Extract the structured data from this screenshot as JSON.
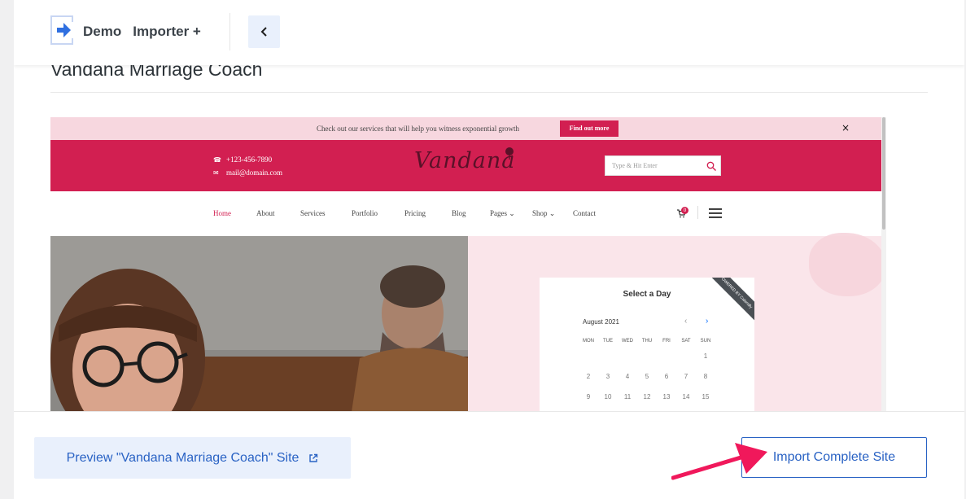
{
  "header": {
    "brand_word1": "Demo",
    "brand_word2": "Importer +",
    "back_icon": "chevron-left-icon"
  },
  "site_title": "Vandana Marriage Coach",
  "site_preview": {
    "topbar": {
      "message": "Check out our services that will help you witness exponential growth",
      "cta": "Find out more",
      "close": "×"
    },
    "contact": {
      "phone": "+123-456-7890",
      "email": "mail@domain.com"
    },
    "logo_text": "Vandana",
    "search_placeholder": "Type & Hit Enter",
    "nav": [
      {
        "label": "Home"
      },
      {
        "label": "About"
      },
      {
        "label": "Services"
      },
      {
        "label": "Portfolio"
      },
      {
        "label": "Pricing"
      },
      {
        "label": "Blog"
      },
      {
        "label": "Pages ⌄"
      },
      {
        "label": "Shop ⌄"
      },
      {
        "label": "Contact"
      }
    ],
    "cart_count": "0",
    "calendar": {
      "title": "Select a Day",
      "month": "August 2021",
      "prev": "‹",
      "next": "›",
      "ribbon": "POWERED BY Calendly",
      "weekdays": [
        "MON",
        "TUE",
        "WED",
        "THU",
        "FRI",
        "SAT",
        "SUN"
      ],
      "week1": [
        "1"
      ],
      "week2": [
        "2",
        "3",
        "4",
        "5",
        "6",
        "7",
        "8"
      ],
      "week3": [
        "9",
        "10",
        "11",
        "12",
        "13",
        "14",
        "15"
      ]
    }
  },
  "footer": {
    "preview_label": "Preview \"Vandana Marriage Coach\" Site",
    "import_label": "Import Complete Site"
  },
  "colors": {
    "accent": "#2962c4",
    "brand_red": "#d21f51",
    "annotation_arrow": "#f0185b"
  }
}
